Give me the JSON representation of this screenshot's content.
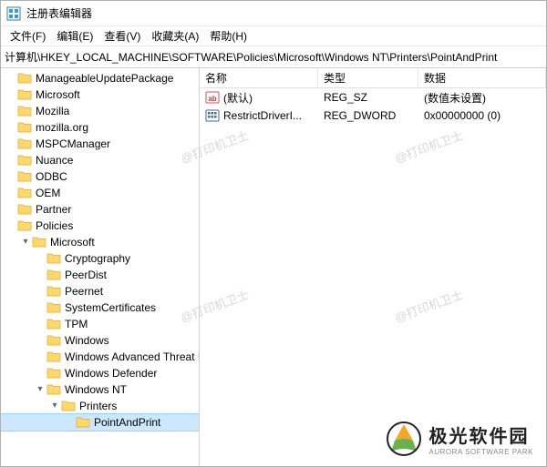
{
  "title": "注册表编辑器",
  "menu": {
    "file": "文件(F)",
    "edit": "编辑(E)",
    "view": "查看(V)",
    "fav": "收藏夹(A)",
    "help": "帮助(H)"
  },
  "path": "计算机\\HKEY_LOCAL_MACHINE\\SOFTWARE\\Policies\\Microsoft\\Windows NT\\Printers\\PointAndPrint",
  "tree": [
    {
      "depth": 0,
      "exp": "",
      "label": "ManageableUpdatePackage"
    },
    {
      "depth": 0,
      "exp": "",
      "label": "Microsoft"
    },
    {
      "depth": 0,
      "exp": "",
      "label": "Mozilla"
    },
    {
      "depth": 0,
      "exp": "",
      "label": "mozilla.org"
    },
    {
      "depth": 0,
      "exp": "",
      "label": "MSPCManager"
    },
    {
      "depth": 0,
      "exp": "",
      "label": "Nuance"
    },
    {
      "depth": 0,
      "exp": "",
      "label": "ODBC"
    },
    {
      "depth": 0,
      "exp": "",
      "label": "OEM"
    },
    {
      "depth": 0,
      "exp": "",
      "label": "Partner"
    },
    {
      "depth": 0,
      "exp": "",
      "label": "Policies"
    },
    {
      "depth": 1,
      "exp": "v",
      "label": "Microsoft"
    },
    {
      "depth": 2,
      "exp": "",
      "label": "Cryptography"
    },
    {
      "depth": 2,
      "exp": "",
      "label": "PeerDist"
    },
    {
      "depth": 2,
      "exp": "",
      "label": "Peernet"
    },
    {
      "depth": 2,
      "exp": "",
      "label": "SystemCertificates"
    },
    {
      "depth": 2,
      "exp": "",
      "label": "TPM"
    },
    {
      "depth": 2,
      "exp": "",
      "label": "Windows"
    },
    {
      "depth": 2,
      "exp": "",
      "label": "Windows Advanced Threat Protection"
    },
    {
      "depth": 2,
      "exp": "",
      "label": "Windows Defender"
    },
    {
      "depth": 2,
      "exp": "v",
      "label": "Windows NT"
    },
    {
      "depth": 3,
      "exp": "v",
      "label": "Printers"
    },
    {
      "depth": 4,
      "exp": "",
      "label": "PointAndPrint",
      "sel": true
    }
  ],
  "cols": {
    "name": "名称",
    "type": "类型",
    "data": "数据"
  },
  "rows": [
    {
      "icon": "sz",
      "name": "(默认)",
      "type": "REG_SZ",
      "data": "(数值未设置)"
    },
    {
      "icon": "dw",
      "name": "RestrictDriverI...",
      "type": "REG_DWORD",
      "data": "0x00000000 (0)"
    }
  ],
  "watermark": "@打印机卫士",
  "brand": {
    "cn": "极光软件园",
    "en": "AURORA SOFTWARE PARK"
  }
}
